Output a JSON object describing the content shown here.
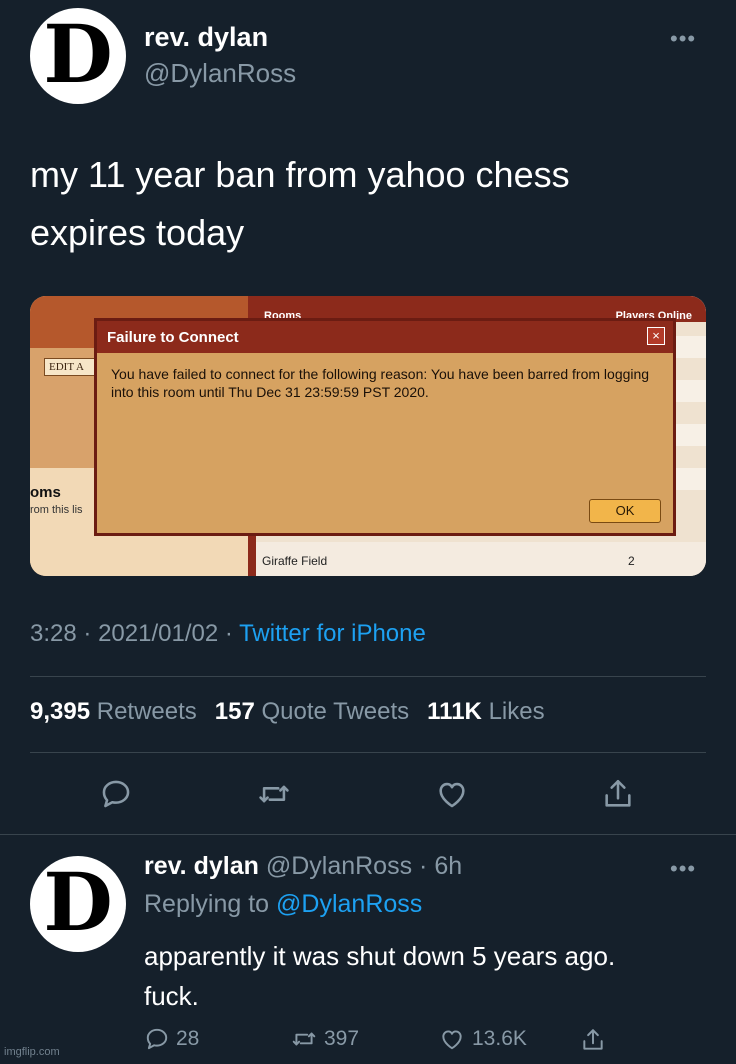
{
  "tweet": {
    "avatar_letter": "D",
    "name": "rev. dylan",
    "handle": "@DylanRoss",
    "more": "•••",
    "text_line1": "my 11 year ban from yahoo chess",
    "text_line2": "expires today",
    "time": "3:28",
    "date": "2021/01/02",
    "source": "Twitter for iPhone",
    "retweets_count": "9,395",
    "retweets_label": "Retweets",
    "quotes_count": "157",
    "quotes_label": "Quote Tweets",
    "likes_count": "111K",
    "likes_label": "Likes"
  },
  "media": {
    "edit_label": "EDIT A",
    "rooms_label": "Rooms",
    "players_label": "Players Online",
    "left_heading": "oms",
    "left_sub": "rom this lis",
    "dialog_title": "Failure to Connect",
    "dialog_message": "You have failed to connect for the following reason: You have been barred from logging into this room until Thu Dec 31 23:59:59 PST 2020.",
    "close_glyph": "×",
    "ok_label": "OK",
    "row_name": "Giraffe Field",
    "row_count": "2"
  },
  "reply": {
    "avatar_letter": "D",
    "name": "rev. dylan",
    "handle": "@DylanRoss",
    "age": "6h",
    "replying_prefix": "Replying to",
    "replying_to": "@DylanRoss",
    "more": "•••",
    "text_line1": "apparently it was shut down 5 years ago.",
    "text_line2": "fuck.",
    "reply_count": "28",
    "retweet_count": "397",
    "like_count": "13.6K"
  },
  "watermark": "imgflip.com",
  "colors": {
    "background": "#15202b",
    "secondary_text": "#8899a6",
    "accent": "#1da1f2",
    "divider": "#38444d"
  },
  "icons": [
    "reply-icon",
    "retweet-icon",
    "like-icon",
    "share-icon"
  ]
}
